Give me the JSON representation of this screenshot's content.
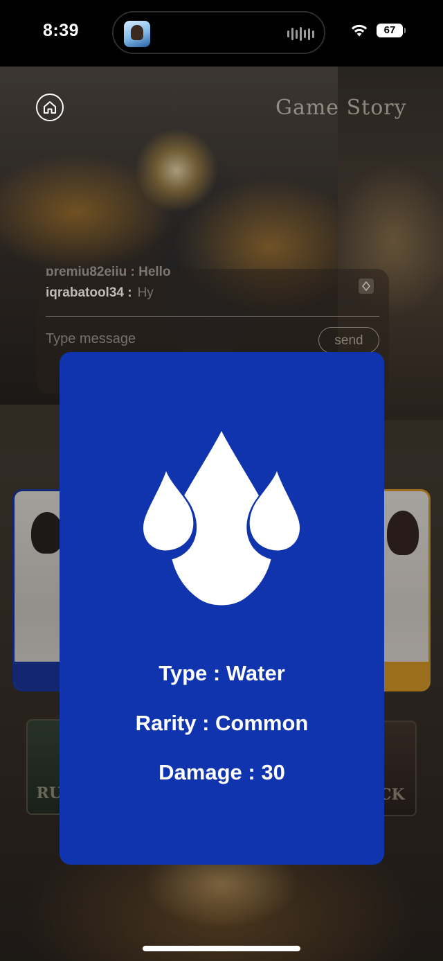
{
  "status_bar": {
    "time": "8:39",
    "battery": "67",
    "island_app_icon": "game-app-icon",
    "waveform_icon": "waveform-icon",
    "wifi_icon": "wifi-icon"
  },
  "header": {
    "title": "Game Story",
    "home_icon": "home-icon"
  },
  "chat": {
    "partial_line": "premiu82eiiu : Hello",
    "messages": [
      {
        "user": "iqrabatool34 :",
        "text": "Hy"
      }
    ],
    "input_placeholder": "Type message",
    "send_label": "send",
    "scroll_icon": "sort-icon"
  },
  "background": {
    "left_button_text": "RU",
    "right_button_text": "CK"
  },
  "card": {
    "type_line": "Type : Water",
    "rarity_line": "Rarity : Common",
    "damage_line": "Damage : 30",
    "icon": "water-drops-icon",
    "color": "#1034ad"
  }
}
